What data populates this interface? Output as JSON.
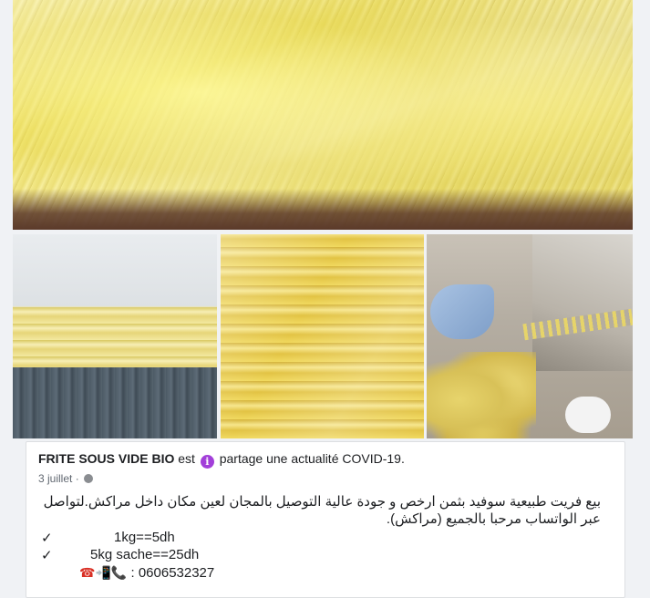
{
  "post": {
    "page_name": "FRITE SOUS VIDE BIO",
    "verb_before": "est",
    "action_text": "partage une actualité COVID-19.",
    "date": "3 juillet",
    "date_separator": "·",
    "body_line1": "بيع فريت طبيعية سوفيد  بثمن ارخص و جودة عالية التوصيل بالمجان لعين مكان داخل مراكش.لتواصل",
    "body_line2": "عبر الواتساب مرحبا بالجميع (مراكش).",
    "items": [
      {
        "check": "✓",
        "text": "1kg==5dh"
      },
      {
        "check": "✓",
        "text": "5kg sache==25dh"
      }
    ],
    "contact_icons": "☎📲📞",
    "contact_text": ": 0606532327"
  },
  "icons": {
    "info_icon": "info-icon",
    "info_glyph": "i",
    "audience_icon": "globe-icon"
  },
  "colors": {
    "info_badge": "#a23fd9",
    "meta_text": "#606770",
    "text": "#1c1e21"
  }
}
